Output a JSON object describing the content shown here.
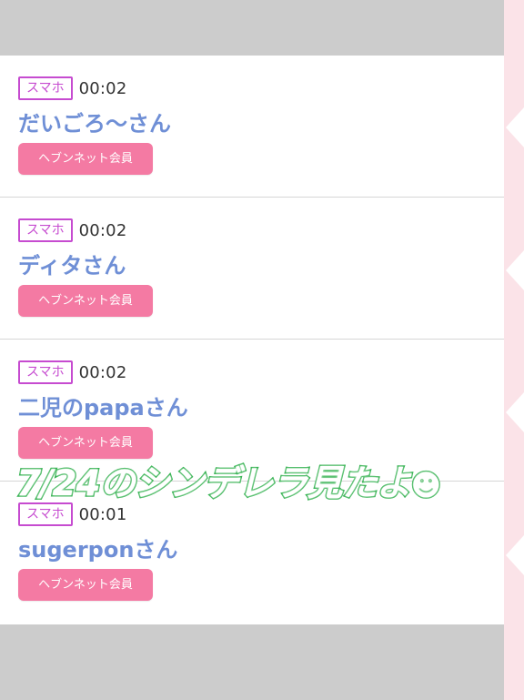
{
  "items": [
    {
      "badge": "スマホ",
      "time": "00:02",
      "name": "だいごろ～さん",
      "member_label": "ヘブンネット会員"
    },
    {
      "badge": "スマホ",
      "time": "00:02",
      "name": "ディタさん",
      "member_label": "ヘブンネット会員"
    },
    {
      "badge": "スマホ",
      "time": "00:02",
      "name": "二児のpapaさん",
      "member_label": "ヘブンネット会員"
    },
    {
      "badge": "スマホ",
      "time": "00:01",
      "name": "sugerponさん",
      "member_label": "ヘブンネット会員"
    }
  ],
  "overlay": {
    "text": "7/24のシンデレラ見たよ",
    "emoji": "☻"
  },
  "colors": {
    "badge": "#c64bd0",
    "name": "#6f8fd6",
    "member_button": "#f47aa3",
    "overlay_outline": "#2fb04c"
  }
}
